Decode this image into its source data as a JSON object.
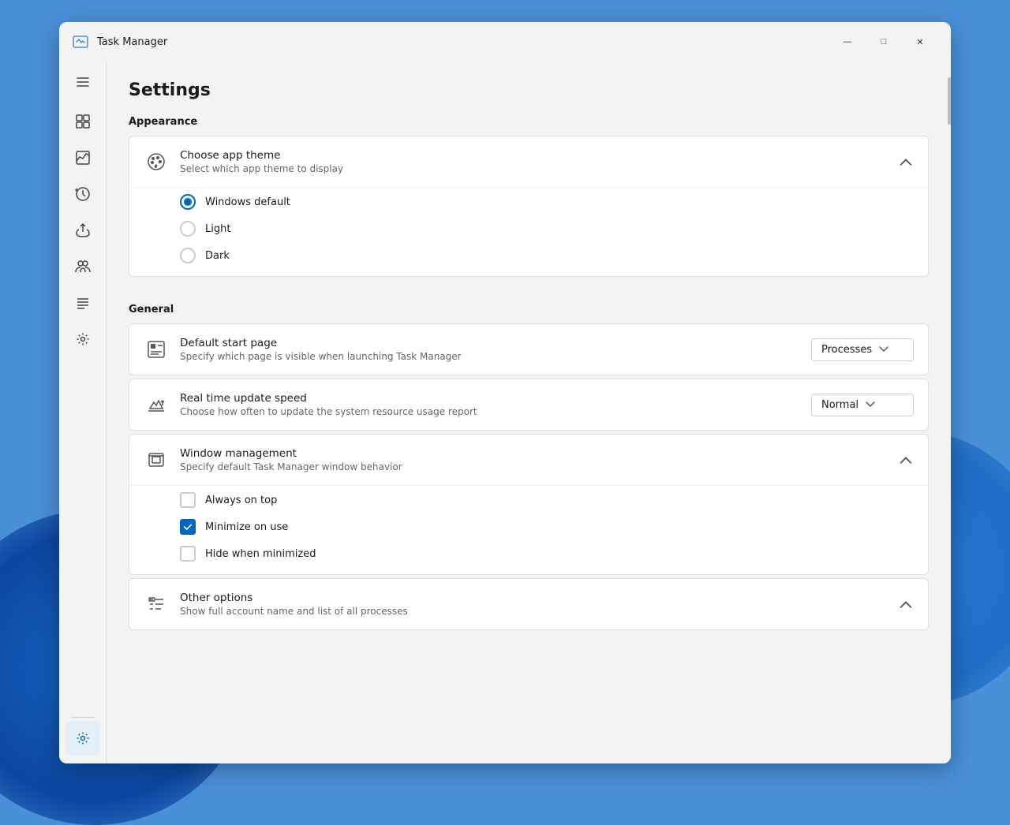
{
  "window": {
    "title": "Task Manager",
    "controls": {
      "minimize": "—",
      "maximize": "□",
      "close": "✕"
    }
  },
  "sidebar": {
    "hamburger_label": "Menu",
    "items": [
      {
        "id": "dashboard",
        "icon": "grid-icon",
        "label": "Dashboard"
      },
      {
        "id": "performance",
        "icon": "performance-icon",
        "label": "Performance"
      },
      {
        "id": "app-history",
        "icon": "history-icon",
        "label": "App history"
      },
      {
        "id": "startup",
        "icon": "startup-icon",
        "label": "Startup apps"
      },
      {
        "id": "users",
        "icon": "users-icon",
        "label": "Users"
      },
      {
        "id": "details",
        "icon": "details-icon",
        "label": "Details"
      },
      {
        "id": "services",
        "icon": "services-icon",
        "label": "Services"
      }
    ],
    "bottom": {
      "id": "settings",
      "icon": "gear-icon",
      "label": "Settings"
    }
  },
  "page": {
    "title": "Settings",
    "sections": [
      {
        "id": "appearance",
        "title": "Appearance",
        "cards": [
          {
            "id": "choose-app-theme",
            "icon": "palette-icon",
            "title": "Choose app theme",
            "subtitle": "Select which app theme to display",
            "expanded": true,
            "chevron": "up",
            "options_type": "radio",
            "options": [
              {
                "id": "windows-default",
                "label": "Windows default",
                "selected": true
              },
              {
                "id": "light",
                "label": "Light",
                "selected": false
              },
              {
                "id": "dark",
                "label": "Dark",
                "selected": false
              }
            ]
          }
        ]
      },
      {
        "id": "general",
        "title": "General",
        "cards": [
          {
            "id": "default-start-page",
            "icon": "start-page-icon",
            "title": "Default start page",
            "subtitle": "Specify which page is visible when launching Task Manager",
            "expanded": false,
            "chevron": "none",
            "has_dropdown": true,
            "dropdown_value": "Processes"
          },
          {
            "id": "real-time-update",
            "icon": "update-speed-icon",
            "title": "Real time update speed",
            "subtitle": "Choose how often to update the system resource usage report",
            "expanded": false,
            "chevron": "none",
            "has_dropdown": true,
            "dropdown_value": "Normal"
          },
          {
            "id": "window-management",
            "icon": "window-mgmt-icon",
            "title": "Window management",
            "subtitle": "Specify default Task Manager window behavior",
            "expanded": true,
            "chevron": "up",
            "options_type": "checkbox",
            "options": [
              {
                "id": "always-on-top",
                "label": "Always on top",
                "checked": false
              },
              {
                "id": "minimize-on-use",
                "label": "Minimize on use",
                "checked": true
              },
              {
                "id": "hide-when-minimized",
                "label": "Hide when minimized",
                "checked": false
              }
            ]
          }
        ]
      },
      {
        "id": "other-options-section",
        "title": "",
        "cards": [
          {
            "id": "other-options",
            "icon": "other-options-icon",
            "title": "Other options",
            "subtitle": "Show full account name and list of all processes",
            "expanded": true,
            "chevron": "up",
            "options_type": "none"
          }
        ]
      }
    ]
  },
  "colors": {
    "accent": "#0067c0",
    "bg": "#f3f3f3",
    "card_bg": "#ffffff",
    "text_primary": "#1a1a1a",
    "text_secondary": "#666666"
  }
}
